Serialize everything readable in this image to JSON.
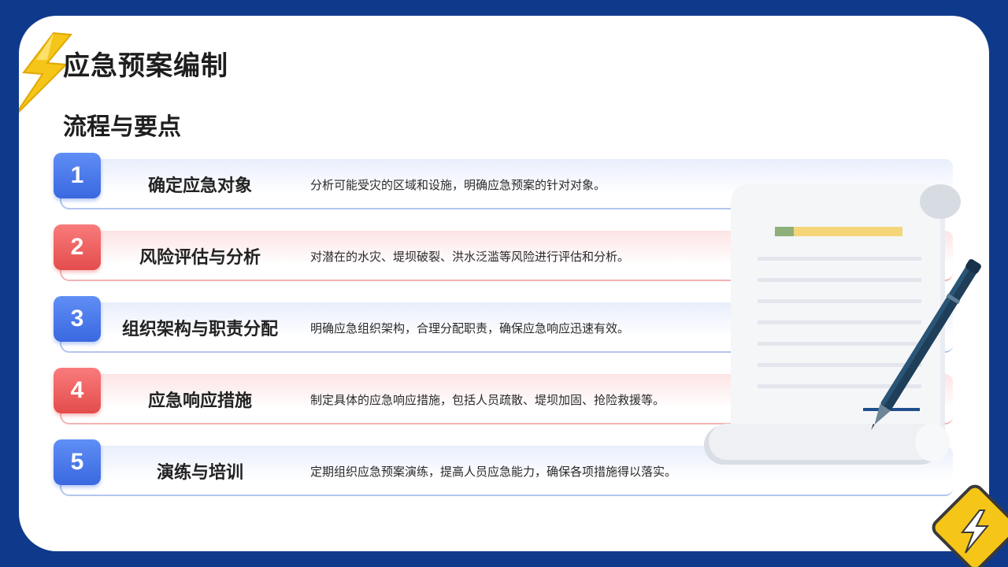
{
  "header": {
    "title": "应急预案编制",
    "subtitle": "流程与要点"
  },
  "steps": [
    {
      "num": "1",
      "title": "确定应急对象",
      "desc": "分析可能受灾的区域和设施，明确应急预案的针对对象。",
      "color": "blue"
    },
    {
      "num": "2",
      "title": "风险评估与分析",
      "desc": "对潜在的水灾、堤坝破裂、洪水泛滥等风险进行评估和分析。",
      "color": "red"
    },
    {
      "num": "3",
      "title": "组织架构与职责分配",
      "desc": "明确应急组织架构，合理分配职责，确保应急响应迅速有效。",
      "color": "blue"
    },
    {
      "num": "4",
      "title": "应急响应措施",
      "desc": "制定具体的应急响应措施，包括人员疏散、堤坝加固、抢险救援等。",
      "color": "red"
    },
    {
      "num": "5",
      "title": "演练与培训",
      "desc": "定期组织应急预案演练，提高人员应急能力，确保各项措施得以落实。",
      "color": "blue"
    }
  ],
  "decor": {
    "illustration": "scroll-and-pen-icon",
    "logo": "lightning-bolt-icon"
  },
  "colors": {
    "background": "#0f3a8c",
    "accent_blue": "#3a68e0",
    "accent_red": "#e44c4c",
    "bolt_yellow": "#f5c518"
  }
}
